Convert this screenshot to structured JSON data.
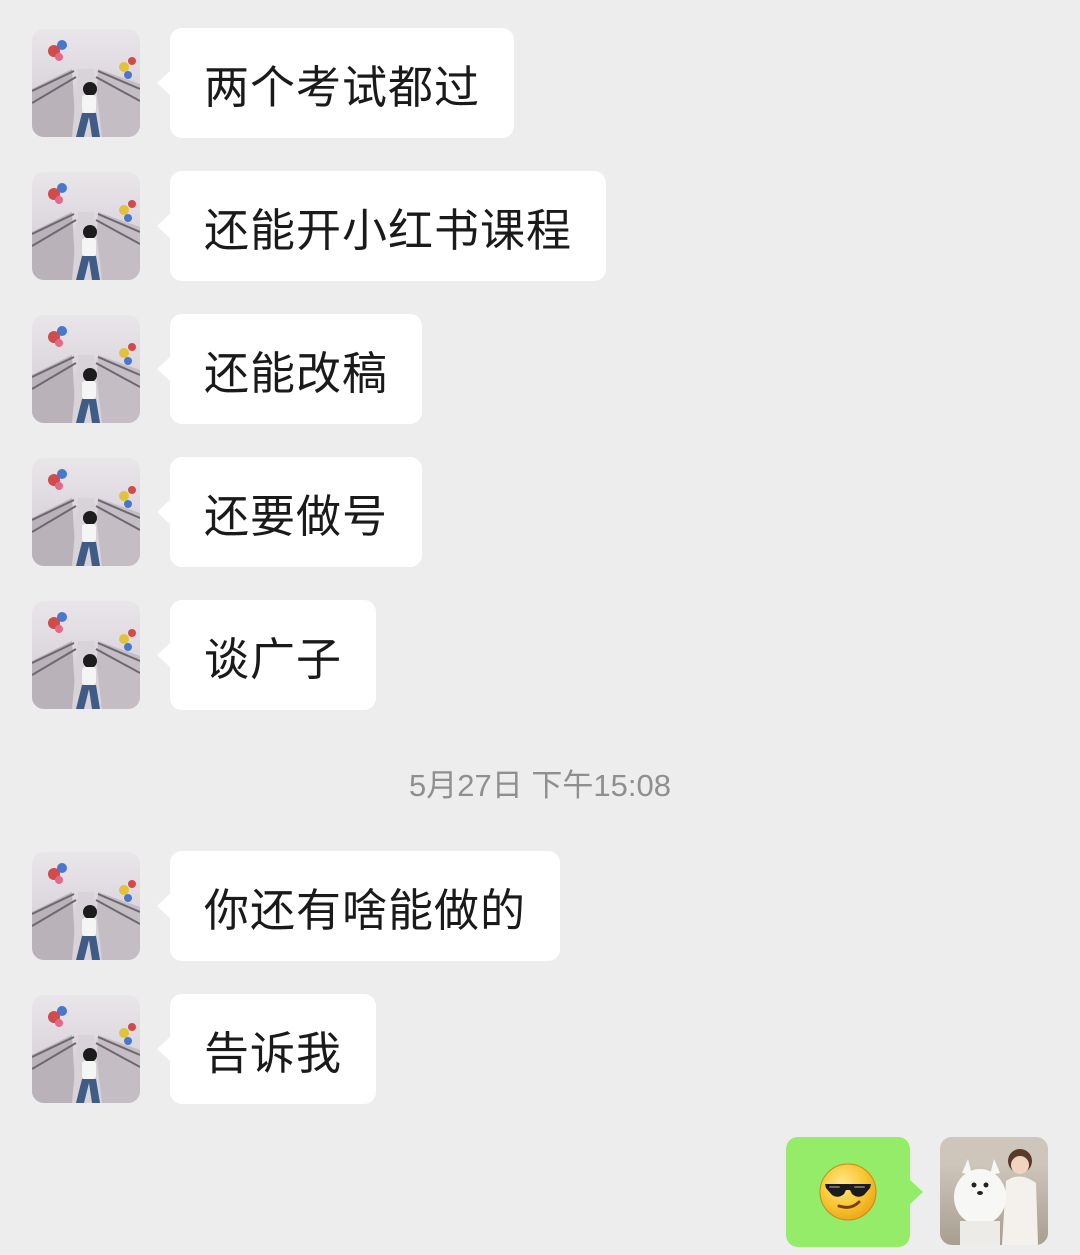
{
  "messages": [
    {
      "sender": "other",
      "text": "两个考试都过"
    },
    {
      "sender": "other",
      "text": "还能开小红书课程"
    },
    {
      "sender": "other",
      "text": "还能改稿"
    },
    {
      "sender": "other",
      "text": "还要做号"
    },
    {
      "sender": "other",
      "text": "谈广子"
    },
    {
      "sender": "other",
      "text": "你还有啥能做的"
    },
    {
      "sender": "other",
      "text": "告诉我"
    },
    {
      "sender": "self",
      "emoji": "😎",
      "icon": "sunglasses-emoji-icon"
    }
  ],
  "timestamp": "5月27日 下午15:08",
  "colors": {
    "background": "#ededed",
    "incoming_bubble": "#ffffff",
    "outgoing_bubble": "#95ec69",
    "timestamp_text": "#8f8f8f"
  }
}
